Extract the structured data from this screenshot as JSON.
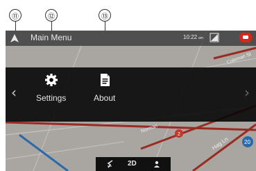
{
  "callouts": [
    "⑪",
    "⑫",
    "⑬"
  ],
  "topbar": {
    "title": "Main Menu",
    "clock": "10:22",
    "ampm": "am"
  },
  "menu": {
    "items": [
      {
        "label": "Settings"
      },
      {
        "label": "About"
      }
    ]
  },
  "map": {
    "streets": [
      "Coleman St",
      "Norman",
      "2",
      "Hag Ln",
      "20"
    ]
  },
  "bottombar": {
    "mode": "2D"
  },
  "icons": {
    "nav_arrow": "navigation-arrow-icon",
    "signal": "signal-icon",
    "message": "message-icon",
    "settings": "gear-icon",
    "about": "document-icon",
    "left": "chevron-left-icon",
    "right": "chevron-right-icon",
    "route": "route-icon",
    "person": "person-icon"
  },
  "colors": {
    "accent": "#d9261c",
    "route_blue": "#2a6aaa",
    "panel": "#080808",
    "map": "#a9a6a2"
  }
}
